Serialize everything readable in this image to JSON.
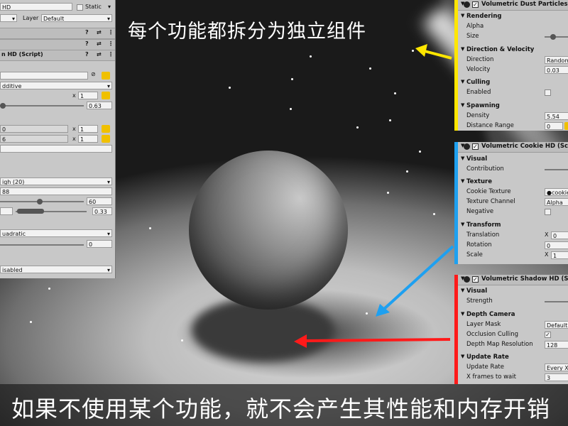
{
  "colors": {
    "dust_accent": "#ffe600",
    "cookie_accent": "#1ea0f0",
    "shadow_accent": "#ff1a1a"
  },
  "captions": {
    "top": "每个功能都拆分为独立组件",
    "bottom": "如果不使用某个功能，就不会产生其性能和内存开销"
  },
  "inspector": {
    "name_value": "HD",
    "static_label": "Static",
    "layer_label": "Layer",
    "layer_value": "Default",
    "script_header": "n HD (Script)",
    "blend_value": "dditive",
    "x_label": "x",
    "x1_value": "1",
    "slider1_value": "0.63",
    "x2_value": "1",
    "x3_value": "1",
    "quality_value": "igh (20)",
    "field_88": "88",
    "slider2_value": "60",
    "range_value": "0.33",
    "falloff_value": "uadratic",
    "slider3_value": "0",
    "shadow_value": "isabled",
    "partial_0": "0",
    "partial_6": "6"
  },
  "dust_panel": {
    "title": "Volumetric Dust Particles (Sc",
    "rendering_header": "Rendering",
    "alpha_label": "Alpha",
    "size_label": "Size",
    "direction_header": "Direction & Velocity",
    "direction_label": "Direction",
    "direction_value": "Random",
    "velocity_label": "Velocity",
    "velocity_value": "0.03",
    "culling_header": "Culling",
    "enabled_label": "Enabled",
    "spawning_header": "Spawning",
    "density_label": "Density",
    "density_value": "5.54",
    "distance_label": "Distance Range",
    "distance_value": "0"
  },
  "cookie_panel": {
    "title": "Volumetric Cookie HD (Script",
    "visual_header": "Visual",
    "contribution_label": "Contribution",
    "texture_header": "Texture",
    "cookie_texture_label": "Cookie Texture",
    "cookie_texture_value": "cookie_",
    "texture_channel_label": "Texture Channel",
    "texture_channel_value": "Alpha",
    "negative_label": "Negative",
    "transform_header": "Transform",
    "translation_label": "Translation",
    "translation_axis": "X",
    "translation_value": "0",
    "rotation_label": "Rotation",
    "rotation_value": "0",
    "scale_label": "Scale",
    "scale_axis": "X",
    "scale_value": "1"
  },
  "shadow_panel": {
    "title": "Volumetric Shadow HD (Scrip",
    "visual_header": "Visual",
    "strength_label": "Strength",
    "depth_header": "Depth Camera",
    "layer_mask_label": "Layer Mask",
    "layer_mask_value": "Default",
    "occlusion_label": "Occlusion Culling",
    "occlusion_check": "✓",
    "depth_res_label": "Depth Map Resolution",
    "depth_res_value": "128",
    "update_header": "Update Rate",
    "update_rate_label": "Update Rate",
    "update_rate_value": "Every X F",
    "frames_label": "X frames to wait",
    "frames_value": "3"
  }
}
